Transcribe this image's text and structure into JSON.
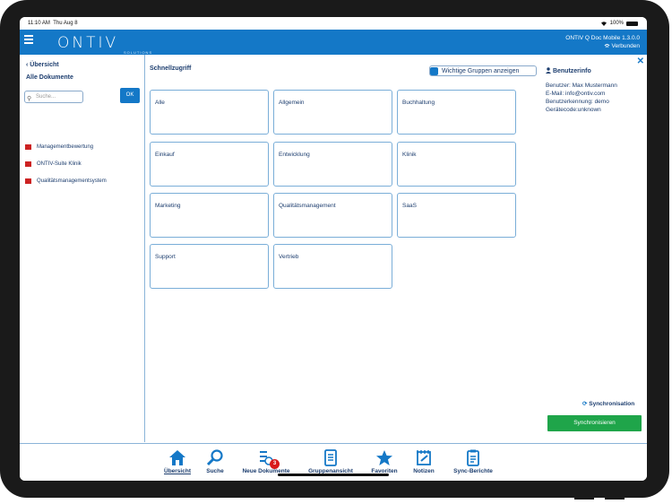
{
  "status": {
    "time": "11:10 AM",
    "date": "Thu Aug 8",
    "battery": "100%"
  },
  "header": {
    "logo": "ONTIV",
    "logo_sub": "SOLUTIONS",
    "app_version": "ONTIV Q Doc Mobile 1.3.0.0",
    "connection": "Verbunden"
  },
  "sidebar": {
    "back_label": "Übersicht",
    "title": "Alle Dokumente",
    "search_placeholder": "Suche...",
    "ok_label": "OK",
    "documents": [
      "Managementbewertung",
      "ONTIV-Suite Klinik",
      "Qualitätsmanagementsystem"
    ]
  },
  "main": {
    "title": "Schnellzugriff",
    "toggle_label": "Wichtige Gruppen anzeigen",
    "tiles": [
      "Alle",
      "Allgemein",
      "Buchhaltung",
      "Einkauf",
      "Entwicklung",
      "Klinik",
      "Marketing",
      "Qualitätsmanagement",
      "SaaS",
      "Support",
      "Vertrieb"
    ]
  },
  "user_info": {
    "title": "Benutzerinfo",
    "user": "Benutzer: Max Mustermann",
    "email": "E-Mail: info@ontiv.com",
    "login": "Benutzerkennung: demo",
    "device": "Gerätecode:unknown",
    "sync_label": "Synchronisation",
    "sync_button": "Synchronisieren"
  },
  "tabbar": {
    "tabs": [
      {
        "label": "Übersicht",
        "icon": "home-icon",
        "active": true
      },
      {
        "label": "Suche",
        "icon": "search-icon"
      },
      {
        "label": "Neue Dokumente",
        "icon": "new-documents-icon",
        "badge": "3"
      },
      {
        "label": "Gruppenansicht",
        "icon": "group-view-icon"
      },
      {
        "label": "Favoriten",
        "icon": "star-icon"
      },
      {
        "label": "Notizen",
        "icon": "notes-icon"
      },
      {
        "label": "Sync-Berichte",
        "icon": "sync-reports-icon"
      }
    ]
  },
  "colors": {
    "primary": "#1478c7",
    "success": "#1fa54a",
    "text": "#1c3d6e",
    "badge": "#d81b1b"
  }
}
